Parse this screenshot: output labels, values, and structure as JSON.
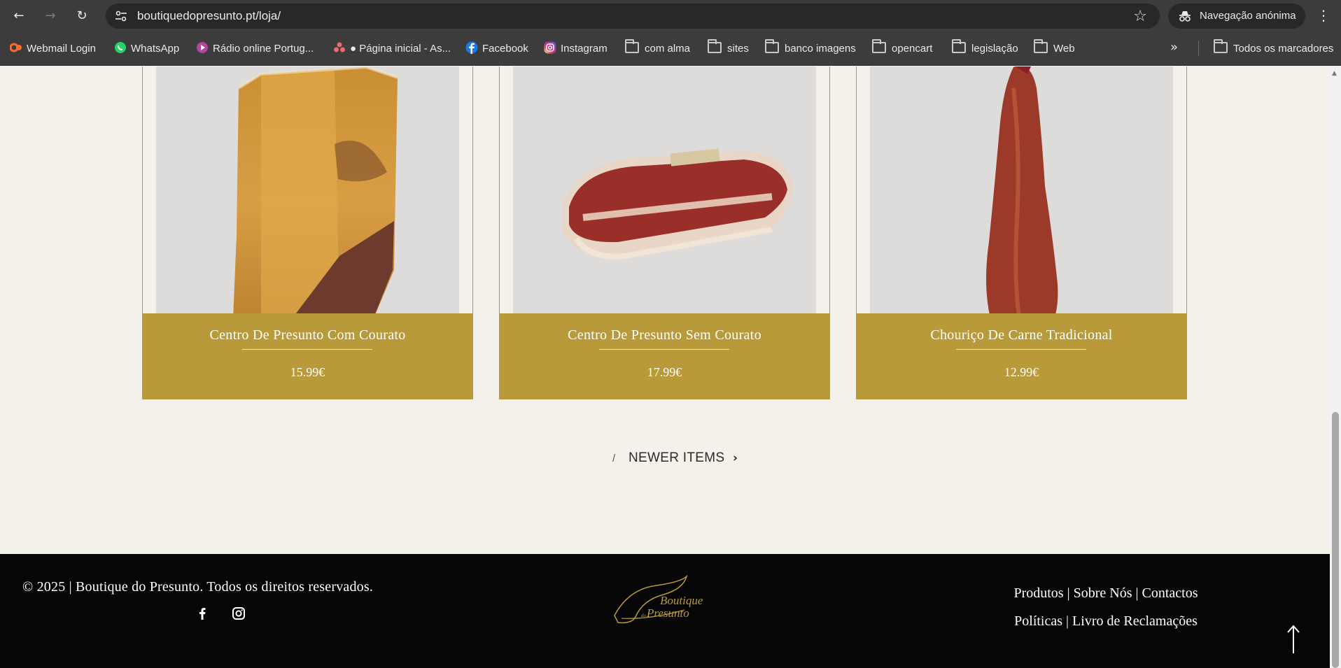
{
  "browser": {
    "url": "boutiquedopresunto.pt/loja/",
    "incognito_label": "Navegação anónima",
    "bookmarks": [
      {
        "label": "Webmail Login",
        "icon": "cpanel-icon"
      },
      {
        "label": "WhatsApp",
        "icon": "whatsapp-icon"
      },
      {
        "label": "Rádio online Portug...",
        "icon": "radio-icon"
      },
      {
        "label": "● Página inicial - As...",
        "icon": "asana-icon"
      },
      {
        "label": "Facebook",
        "icon": "facebook-icon"
      },
      {
        "label": "Instagram",
        "icon": "instagram-icon"
      },
      {
        "label": "com alma",
        "icon": "folder-icon"
      },
      {
        "label": "sites",
        "icon": "folder-icon"
      },
      {
        "label": "banco imagens",
        "icon": "folder-icon"
      },
      {
        "label": "opencart",
        "icon": "folder-icon"
      },
      {
        "label": "legislação",
        "icon": "folder-icon"
      },
      {
        "label": "Web",
        "icon": "folder-icon"
      }
    ],
    "all_bookmarks_label": "Todos os marcadores"
  },
  "products": [
    {
      "name": "Centro De Presunto Com Courato",
      "price": "15.99€"
    },
    {
      "name": "Centro De Presunto Sem Courato",
      "price": "17.99€"
    },
    {
      "name": "Chouriço De Carne Tradicional",
      "price": "12.99€"
    }
  ],
  "pagination": {
    "separator": "/",
    "newer_label": "NEWER ITEMS"
  },
  "footer": {
    "copyright": "© 2025 | Boutique do Presunto. Todos os direitos reservados.",
    "links_line1": [
      {
        "label": "Produtos"
      },
      {
        "label": "Sobre Nós"
      },
      {
        "label": "Contactos"
      }
    ],
    "links_line2": [
      {
        "label": "Políticas"
      },
      {
        "label": "Livro de Reclamações"
      }
    ],
    "link_separator": "|",
    "logo_text_1": "Boutique",
    "logo_text_2": "Presunto",
    "logo_text_small": "do"
  },
  "colors": {
    "brand_gold": "#b99a3a",
    "page_background": "#f4f1ea",
    "footer_background": "#060606"
  }
}
